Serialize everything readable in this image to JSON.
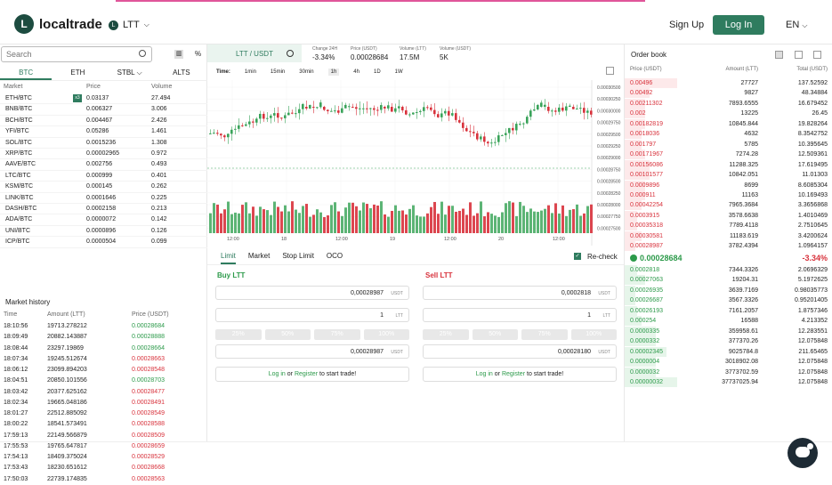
{
  "header": {
    "logo_text": "localtrade",
    "coin": "LTT",
    "signup": "Sign Up",
    "login": "Log In",
    "lang": "EN"
  },
  "markets": {
    "search_placeholder": "Search",
    "pct_label": "%",
    "tabs": [
      "BTC",
      "ETH",
      "STBL",
      "ALTS"
    ],
    "headers": [
      "Market",
      "Price",
      "Volume"
    ],
    "badge": "x3",
    "rows": [
      [
        "ETH/BTC",
        "0.03137",
        "27.494"
      ],
      [
        "BNB/BTC",
        "0.006327",
        "3.006"
      ],
      [
        "BCH/BTC",
        "0.004467",
        "2.426"
      ],
      [
        "YFI/BTC",
        "0.05286",
        "1.461"
      ],
      [
        "SOL/BTC",
        "0.0015236",
        "1.308"
      ],
      [
        "XRP/BTC",
        "0.00002965",
        "0.972"
      ],
      [
        "AAVE/BTC",
        "0.002756",
        "0.493"
      ],
      [
        "LTC/BTC",
        "0.000999",
        "0.401"
      ],
      [
        "KSM/BTC",
        "0.000145",
        "0.262"
      ],
      [
        "LINK/BTC",
        "0.0001646",
        "0.225"
      ],
      [
        "DASH/BTC",
        "0.0002158",
        "0.213"
      ],
      [
        "ADA/BTC",
        "0.0000072",
        "0.142"
      ],
      [
        "UNI/BTC",
        "0.0000896",
        "0.126"
      ],
      [
        "ICP/BTC",
        "0.0000504",
        "0.099"
      ]
    ]
  },
  "history": {
    "title": "Market history",
    "headers": [
      "Time",
      "Amount (LTT)",
      "Price (USDT)"
    ],
    "rows": [
      [
        "18:10:56",
        "19713.278212",
        "0.00028684",
        "g"
      ],
      [
        "18:09:49",
        "20882.143887",
        "0.00028888",
        "g"
      ],
      [
        "18:08:44",
        "23297.19869",
        "0.00028664",
        "g"
      ],
      [
        "18:07:34",
        "19245.512674",
        "0.00028663",
        "r"
      ],
      [
        "18:06:12",
        "23099.894203",
        "0.00028548",
        "r"
      ],
      [
        "18:04:51",
        "20850.101556",
        "0.00028703",
        "g"
      ],
      [
        "18:03:42",
        "20377.625162",
        "0.00028477",
        "r"
      ],
      [
        "18:02:34",
        "19665.048186",
        "0.00028491",
        "r"
      ],
      [
        "18:01:27",
        "22512.885092",
        "0.00028549",
        "r"
      ],
      [
        "18:00:22",
        "18541.573491",
        "0.00028588",
        "r"
      ],
      [
        "17:59:13",
        "22149.566879",
        "0.00028509",
        "r"
      ],
      [
        "17:55:53",
        "19765.647817",
        "0.00028659",
        "r"
      ],
      [
        "17:54:13",
        "18409.375024",
        "0.00028529",
        "r"
      ],
      [
        "17:53:43",
        "18230.651612",
        "0.00028668",
        "r"
      ],
      [
        "17:50:03",
        "22739.174835",
        "0.00028563",
        "r"
      ]
    ]
  },
  "pair": {
    "name": "LTT / USDT",
    "stats": [
      {
        "label": "Change 24H",
        "value": "-3.34%",
        "cls": "red"
      },
      {
        "label": "Price (USDT)",
        "value": "0.00028684",
        "cls": ""
      },
      {
        "label": "Volume (LTT)",
        "value": "17.5M",
        "cls": ""
      },
      {
        "label": "Volume (USDT)",
        "value": "5K",
        "cls": ""
      }
    ]
  },
  "timebar": {
    "label": "Time:",
    "items": [
      "1min",
      "15min",
      "30min",
      "1h",
      "4h",
      "1D",
      "1W"
    ],
    "active": 3
  },
  "chart_data": {
    "type": "candlestick",
    "x_labels": [
      "12:00",
      "18",
      "12:00",
      "19",
      "12:00",
      "20",
      "12:00"
    ],
    "y_ticks": [
      "0.00030500",
      "0.00030250",
      "0.00030000",
      "0.00029750",
      "0.00029500",
      "0.00029250",
      "0.00029000",
      "0.00028750",
      "0.00028500",
      "0.00028250",
      "0.00028000",
      "0.00027750",
      "0.00027500"
    ],
    "last_price": 0.00028684
  },
  "order_tabs": [
    "Limit",
    "Market",
    "Stop Limit",
    "OCO"
  ],
  "recheck": "Re-check",
  "buy": {
    "title": "Buy LTT",
    "price": "0,00028987",
    "price_unit": "USDT",
    "amount": "1",
    "amount_unit": "LTT",
    "total": "0,00028987",
    "total_unit": "USDT"
  },
  "sell": {
    "title": "Sell LTT",
    "price": "0,0002818",
    "price_unit": "USDT",
    "amount": "1",
    "amount_unit": "LTT",
    "total": "0,00028180",
    "total_unit": "USDT"
  },
  "pcts": [
    "25%",
    "50%",
    "75%",
    "100%"
  ],
  "login_msg": {
    "login": "Log in",
    "or": "or",
    "register": "Register",
    "rest": "to start trade!"
  },
  "orderbook": {
    "title": "Order book",
    "headers": [
      "Price (USDT)",
      "Amount (LTT)",
      "Total (USDT)"
    ],
    "asks": [
      [
        "0.00496",
        "27727",
        "137.52592",
        0.25
      ],
      [
        "0.00492",
        "9827",
        "48.34884",
        0.12
      ],
      [
        "0.00211302",
        "7893.6555",
        "16.679452",
        0.1
      ],
      [
        "0.002",
        "13225",
        "26.45",
        0.1
      ],
      [
        "0.00182819",
        "10845.844",
        "19.828264",
        0.1
      ],
      [
        "0.0018036",
        "4632",
        "8.3542752",
        0.08
      ],
      [
        "0.001797",
        "5785",
        "10.395645",
        0.08
      ],
      [
        "0.00171967",
        "7274.28",
        "12.509361",
        0.1
      ],
      [
        "0.00156086",
        "11288.325",
        "17.619495",
        0.12
      ],
      [
        "0.00101577",
        "10842.051",
        "11.01303",
        0.12
      ],
      [
        "0.0009896",
        "8699",
        "8.6085304",
        0.1
      ],
      [
        "0.000911",
        "11163",
        "10.169493",
        0.1
      ],
      [
        "0.00042254",
        "7965.3684",
        "3.3656868",
        0.08
      ],
      [
        "0.0003915",
        "3578.6638",
        "1.4010469",
        0.06
      ],
      [
        "0.00035318",
        "7789.4118",
        "2.7510645",
        0.06
      ],
      [
        "0.00030581",
        "11183.619",
        "3.4200624",
        0.08
      ],
      [
        "0.00028987",
        "3782.4394",
        "1.0964157",
        0.05
      ]
    ],
    "mid": "0.00028684",
    "mid_change": "-3.34%",
    "bids": [
      [
        "0.0002818",
        "7344.3326",
        "2.0696329",
        0.06
      ],
      [
        "0.00027063",
        "19204.31",
        "5.1972625",
        0.1
      ],
      [
        "0.00026935",
        "3639.7169",
        "0.98035773",
        0.05
      ],
      [
        "0.00026687",
        "3567.3326",
        "0.95201405",
        0.05
      ],
      [
        "0.00026193",
        "7161.2057",
        "1.8757346",
        0.06
      ],
      [
        "0.000254",
        "16588",
        "4.213352",
        0.08
      ],
      [
        "0.0000335",
        "359958.61",
        "12.283551",
        0.15
      ],
      [
        "0.0000332",
        "377370.26",
        "12.075848",
        0.15
      ],
      [
        "0.00002345",
        "9025784.8",
        "211.65465",
        0.2
      ],
      [
        "0.0000004",
        "3018902.08",
        "12.075848",
        0.15
      ],
      [
        "0.0000032",
        "3773702.59",
        "12.075848",
        0.15
      ],
      [
        "0.00000032",
        "37737025.94",
        "12.075848",
        0.25
      ]
    ]
  }
}
